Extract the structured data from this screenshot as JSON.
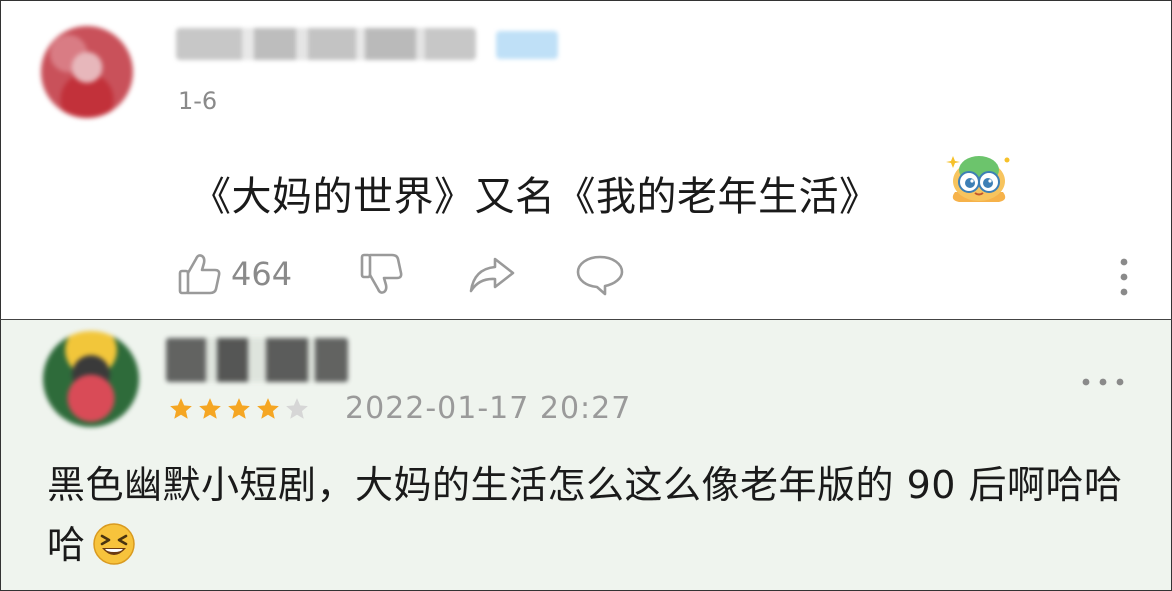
{
  "comment1": {
    "username": "",
    "date": "1-6",
    "content": "《大妈的世界》又名《我的老年生活》",
    "emoji_icon": "cute-bird-sticker-icon",
    "like_count": "464"
  },
  "comment2": {
    "username": "",
    "rating": 4,
    "rating_max": 5,
    "datetime": "2022-01-17 20:27",
    "content": "黑色幽默小短剧，大妈的生活怎么这么像老年版的 90 后啊哈哈哈",
    "emoji_icon": "laughing-face-icon"
  },
  "colors": {
    "star_filled": "#f5a623",
    "star_empty": "#d6d6d6",
    "comment2_bg": "#eff4ee",
    "icon_gray": "#9a9a9a"
  }
}
